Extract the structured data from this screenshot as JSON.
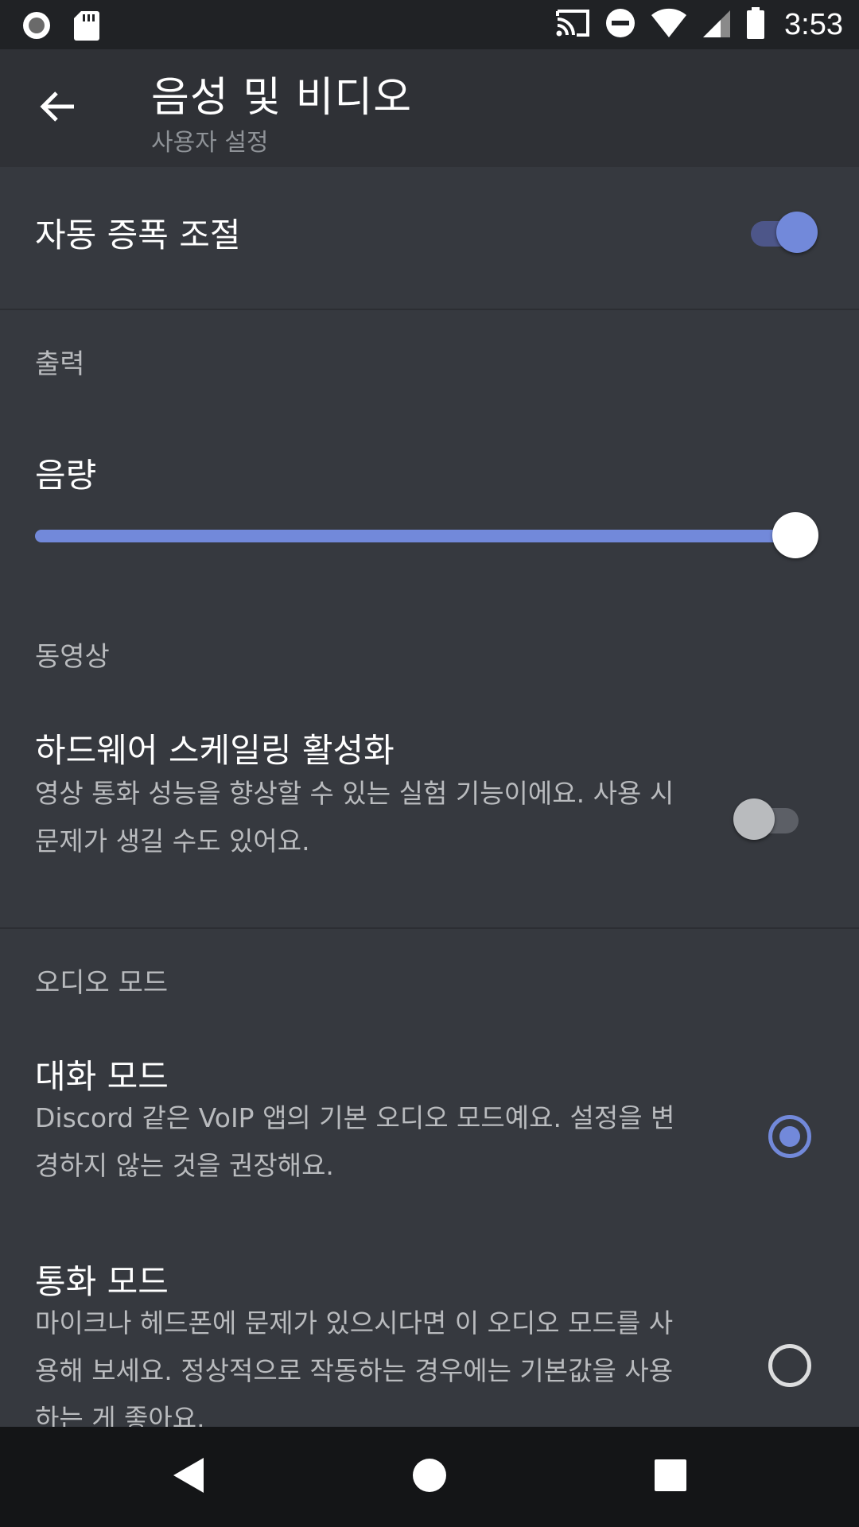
{
  "status_bar": {
    "time": "3:53",
    "icons": [
      "record-icon",
      "sd-card-icon",
      "cast-icon",
      "do-not-disturb-icon",
      "wifi-icon",
      "cell-signal-icon",
      "battery-icon"
    ]
  },
  "app_bar": {
    "title": "음성 및 비디오",
    "subtitle": "사용자 설정",
    "back_icon": "arrow-back-icon"
  },
  "settings": {
    "auto_gain": {
      "label": "자동 증폭 조절",
      "enabled": true
    },
    "output": {
      "section_label": "출력",
      "volume_label": "음량",
      "volume_level": 1.0
    },
    "video": {
      "section_label": "동영상",
      "hardware_scaling": {
        "label": "하드웨어 스케일링 활성화",
        "description": "영상 통화 성능을 향상할 수 있는 실험 기능이에요. 사용 시 문제가 생길 수도 있어요.",
        "enabled": false
      }
    },
    "audio_mode": {
      "section_label": "오디오 모드",
      "options": [
        {
          "label": "대화 모드",
          "description": "Discord 같은 VoIP 앱의 기본 오디오 모드예요. 설정을 변경하지 않는 것을 권장해요.",
          "selected": true
        },
        {
          "label": "통화 모드",
          "description": "마이크나 헤드폰에 문제가 있으시다면 이 오디오 모드를 사용해 보세요. 정상적으로 작동하는 경우에는 기본값을 사용하는 게 좋아요.",
          "selected": false
        }
      ]
    }
  },
  "colors": {
    "accent": "#7289da",
    "background": "#36393f",
    "header": "#2f3136",
    "status_bar": "#202225",
    "nav_bar": "#141517"
  },
  "nav_bar": {
    "icons": [
      "nav-back-icon",
      "nav-home-icon",
      "nav-recents-icon"
    ]
  }
}
